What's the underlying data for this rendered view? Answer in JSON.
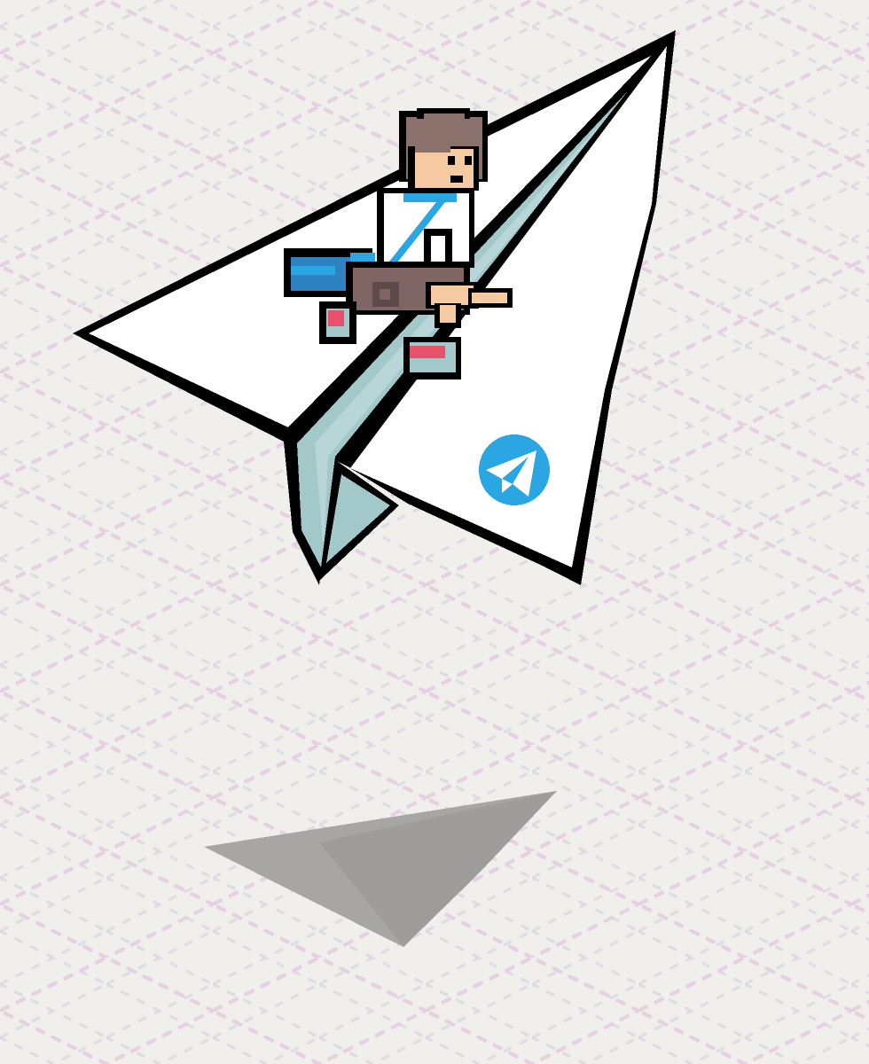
{
  "scene": {
    "background_color": "#f0efec",
    "grid_colors": {
      "primary": "#e6cfe0",
      "secondary": "#dcdde2"
    },
    "plane_colors": {
      "outline": "#000000",
      "body": "#ffffff",
      "fold": "#a3c8c9",
      "shadow": "#a7a6a5"
    },
    "character_colors": {
      "hair": "#8a716b",
      "skin": "#f5c9a1",
      "shirt": "#ffffff",
      "strap": "#2aa6e3",
      "pants": "#7f6664",
      "bag": "#2f82c2",
      "shoes": "#e8506c"
    },
    "logo": {
      "icon": "telegram-paper-plane-icon",
      "color": "#2aa6e3"
    }
  }
}
